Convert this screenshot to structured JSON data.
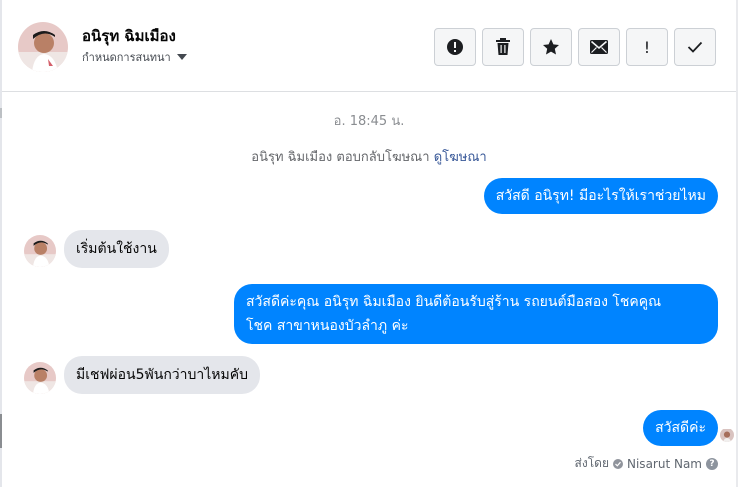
{
  "contact": {
    "name": "อนิรุท ฉิมเมือง",
    "assign_label": "กำหนดการสนทนา",
    "avatar_icon": "person-avatar-photo"
  },
  "toolbar": {
    "buttons": [
      {
        "name": "mark-spam",
        "icon": "exclamation-circle-icon"
      },
      {
        "name": "delete",
        "icon": "trash-icon"
      },
      {
        "name": "star",
        "icon": "star-icon"
      },
      {
        "name": "mark-unread",
        "icon": "envelope-icon"
      },
      {
        "name": "follow-up",
        "icon": "exclamation-icon",
        "glyph": "!"
      },
      {
        "name": "mark-done",
        "icon": "checkmark-icon"
      }
    ]
  },
  "thread": {
    "timestamp": "อ. 18:45 น.",
    "system_note": {
      "text": "อนิรุท ฉิมเมือง ตอบกลับโฆษณา",
      "link": "ดูโฆษณา"
    },
    "messages": [
      {
        "direction": "out",
        "text": "สวัสดี อนิรุท! มีอะไรให้เราช่วยไหม"
      },
      {
        "direction": "in",
        "text": "เริ่มต้นใช้งาน"
      },
      {
        "direction": "out",
        "line1": "สวัสดีค่ะคุณ อนิรุท ฉิมเมือง ยินดีต้อนรับสู่ร้าน รถยนต์มือสอง โชคคูณ",
        "line2": "โชค สาขาหนองบัวลำภู ค่ะ"
      },
      {
        "direction": "in",
        "text": "มีเชฟผ่อน5พันกว่าบาไหมคับ"
      },
      {
        "direction": "out",
        "text": "สวัสดีค่ะ"
      }
    ],
    "sent_by_label": "ส่งโดย",
    "sent_by_name": "Nisarut Nam",
    "help_glyph": "?"
  },
  "colors": {
    "accent": "#0084ff",
    "incoming_bubble": "#e4e6eb",
    "link": "#385898"
  }
}
